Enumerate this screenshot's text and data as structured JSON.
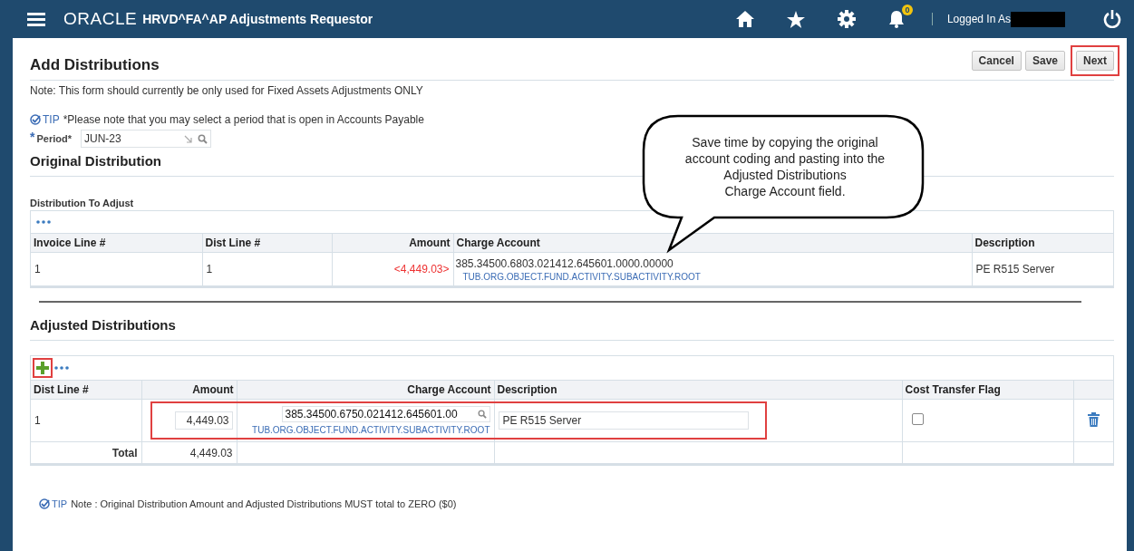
{
  "header": {
    "logo": "ORACLE",
    "title": "HRVD^FA^AP Adjustments Requestor",
    "notification_count": "0",
    "logged_in_label": "Logged In As"
  },
  "page": {
    "title": "Add Distributions",
    "buttons": [
      {
        "label": "Cancel",
        "highlighted": false
      },
      {
        "label": "Save",
        "highlighted": false
      },
      {
        "label": "Next",
        "highlighted": true
      }
    ],
    "note": "Note: This form should currently be only used for Fixed Assets Adjustments ONLY",
    "tip": {
      "label": "TIP",
      "text": "*Please note that you may select a period that is open in Accounts Payable"
    },
    "period": {
      "required_mark": "*",
      "label": "Period*",
      "value": "JUN-23"
    }
  },
  "original": {
    "title": "Original Distribution",
    "subtitle": "Distribution To Adjust",
    "columns": [
      "Invoice Line #",
      "Dist Line #",
      "Amount",
      "Charge Account",
      "Description"
    ],
    "rows": [
      {
        "invoice_line": "1",
        "dist_line": "1",
        "amount": "<4,449.03>",
        "negative": true,
        "charge_account": "385.34500.6803.021412.645601.0000.00000",
        "account_structure": "TUB.ORG.OBJECT.FUND.ACTIVITY.SUBACTIVITY.ROOT",
        "description": "PE R515 Server"
      }
    ]
  },
  "callout": {
    "lines": [
      "Save time by copying the original",
      "account coding and pasting into the",
      "Adjusted Distributions",
      "Charge Account field."
    ]
  },
  "adjusted": {
    "title": "Adjusted Distributions",
    "add_highlighted": true,
    "columns": [
      "Dist Line #",
      "Amount",
      "Charge Account",
      "Description",
      "Cost Transfer Flag"
    ],
    "rows": [
      {
        "dist_line": "1",
        "amount": "4,449.03",
        "charge_account": "385.34500.6750.021412.645601.00",
        "account_structure": "TUB.ORG.OBJECT.FUND.ACTIVITY.SUBACTIVITY.ROOT",
        "description": "PE R515 Server",
        "cost_transfer_flag": false,
        "highlighted": true
      }
    ],
    "total": {
      "label": "Total",
      "amount": "4,449.03"
    }
  },
  "footer_tip": {
    "label": "TIP",
    "text": "Note : Original Distribution Amount and Adjusted Distributions MUST total to ZERO ($0)"
  }
}
